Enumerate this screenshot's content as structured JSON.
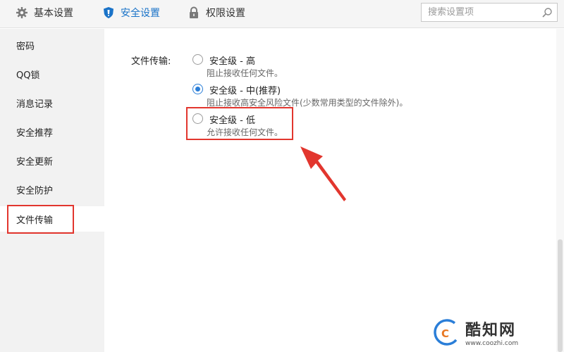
{
  "tabs": [
    {
      "label": "基本设置",
      "icon": "gear-icon"
    },
    {
      "label": "安全设置",
      "icon": "shield-icon",
      "active": true
    },
    {
      "label": "权限设置",
      "icon": "lock-icon"
    }
  ],
  "search": {
    "placeholder": "搜索设置项",
    "icon": "search-icon"
  },
  "sidebar": {
    "items": [
      {
        "label": "密码"
      },
      {
        "label": "QQ锁"
      },
      {
        "label": "消息记录"
      },
      {
        "label": "安全推荐"
      },
      {
        "label": "安全更新"
      },
      {
        "label": "安全防护"
      },
      {
        "label": "文件传输",
        "active": true
      }
    ]
  },
  "file_transfer": {
    "label": "文件传输:",
    "options": [
      {
        "title": "安全级 - 高",
        "desc": "阻止接收任何文件。",
        "checked": false
      },
      {
        "title": "安全级 - 中(推荐)",
        "desc": "阻止接收高安全风险文件(少数常用类型的文件除外)。",
        "checked": true
      },
      {
        "title": "安全级 - 低",
        "desc": "允许接收任何文件。",
        "checked": false
      }
    ]
  },
  "colors": {
    "accent": "#1a73c8",
    "highlight": "#e2362e"
  },
  "watermark": {
    "name": "酷知网",
    "url": "www.coozhi.com"
  }
}
